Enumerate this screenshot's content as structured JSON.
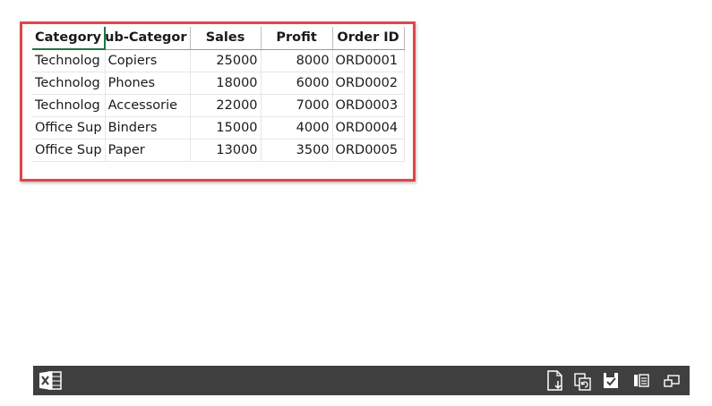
{
  "sheet": {
    "columns": [
      "Category",
      "ub-Categor",
      "Sales",
      "Profit",
      "Order ID"
    ],
    "rows": [
      [
        "Technolog",
        "Copiers",
        "25000",
        "8000",
        "ORD0001"
      ],
      [
        "Technolog",
        "Phones",
        "18000",
        "6000",
        "ORD0002"
      ],
      [
        "Technolog",
        "Accessorie",
        "22000",
        "7000",
        "ORD0003"
      ],
      [
        "Office Sup",
        "Binders",
        "15000",
        "4000",
        "ORD0004"
      ],
      [
        "Office Sup",
        "Paper",
        "13000",
        "3500",
        "ORD0005"
      ]
    ]
  },
  "colors": {
    "highlight_border": "#e0464a",
    "taskbar_bg": "#3f3f3f",
    "active_cell": "#217346"
  },
  "taskbar": {
    "icons": [
      "excel-icon",
      "export-icon",
      "refresh-copy-icon",
      "save-check-icon",
      "reading-view-icon",
      "restore-window-icon"
    ]
  }
}
